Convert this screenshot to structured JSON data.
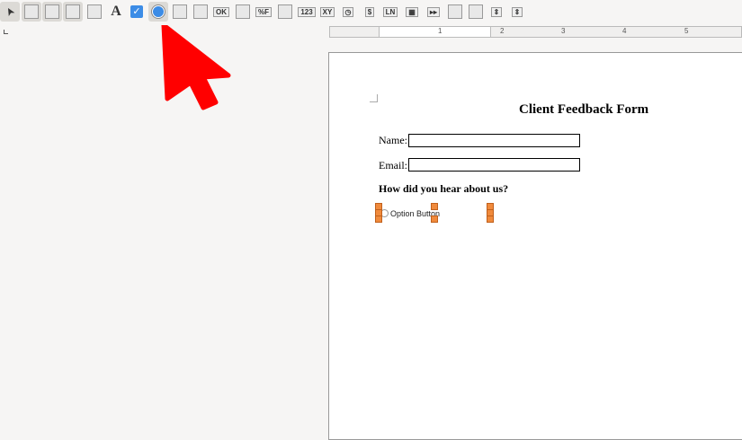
{
  "toolbar": {
    "items": [
      {
        "name": "select-icon",
        "active": true
      },
      {
        "name": "design-mode-icon",
        "active": true
      },
      {
        "name": "control-wizards-icon",
        "active": true
      },
      {
        "name": "form-design-icon",
        "active": true
      },
      {
        "name": "label-icon"
      },
      {
        "name": "text-box-icon",
        "glyph": "A"
      },
      {
        "name": "check-box-icon",
        "glyph": "✓"
      },
      {
        "name": "option-button-icon",
        "active": true
      },
      {
        "name": "list-box-icon"
      },
      {
        "name": "combo-box-icon"
      },
      {
        "name": "push-button-icon",
        "glyph": "OK"
      },
      {
        "name": "image-button-icon"
      },
      {
        "name": "formatted-field-icon",
        "glyph": "%F"
      },
      {
        "name": "group-box-icon"
      },
      {
        "name": "numeric-field-icon",
        "glyph": "123"
      },
      {
        "name": "date-field-icon",
        "glyph": "XY"
      },
      {
        "name": "time-field-icon",
        "glyph": "◷"
      },
      {
        "name": "currency-field-icon",
        "glyph": "$"
      },
      {
        "name": "pattern-field-icon",
        "glyph": "LN"
      },
      {
        "name": "table-control-icon",
        "glyph": "▦"
      },
      {
        "name": "navigation-bar-icon",
        "glyph": "▸▸"
      },
      {
        "name": "image-control-icon"
      },
      {
        "name": "file-selection-icon"
      },
      {
        "name": "spin-button-icon",
        "glyph": "⇕"
      },
      {
        "name": "scrollbar-icon",
        "glyph": "⇕"
      }
    ]
  },
  "ruler": {
    "numbers": [
      "1",
      "2",
      "3",
      "4",
      "5"
    ]
  },
  "form": {
    "title": "Client Feedback Form",
    "name_label": "Name:",
    "email_label": "Email:",
    "question": "How did you hear about us?",
    "option_label": "Option Button"
  }
}
